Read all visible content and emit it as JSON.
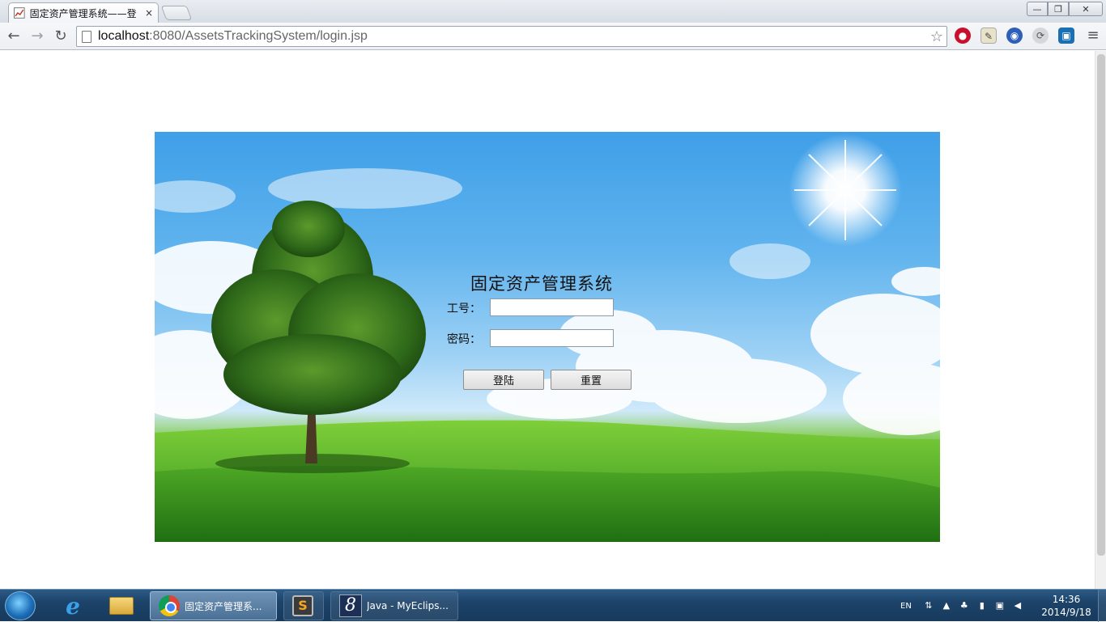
{
  "browser": {
    "tab_title": "固定资产管理系统——登",
    "tab_close": "×",
    "url_host": "localhost",
    "url_path": ":8080/AssetsTrackingSystem/login.jsp",
    "window_controls": {
      "minimize": "—",
      "maximize": "❐",
      "close": "✕"
    },
    "nav": {
      "back": "←",
      "forward": "→",
      "reload": "↻"
    },
    "bookmark_star": "☆",
    "menu": "≡"
  },
  "page": {
    "title": "固定资产管理系统",
    "id_label": "工号：",
    "password_label": "密码：",
    "id_value": "",
    "password_value": "",
    "login_button": "登陆",
    "reset_button": "重置"
  },
  "taskbar": {
    "tasks": [
      {
        "label": "固定资产管理系..."
      },
      {
        "label": ""
      },
      {
        "label": "Java - MyEclips..."
      }
    ],
    "tray_lang": "EN",
    "clock_time": "14:36",
    "clock_date": "2014/9/18"
  },
  "icons": {
    "favicon": "chart-favicon-icon",
    "ext_1": "adblock-icon",
    "ext_2": "notes-extension-icon",
    "ext_3": "globe-extension-icon",
    "ext_4": "sync-extension-icon",
    "ext_5": "dictionary-extension-icon"
  },
  "colors": {
    "sky_top": "#3f9fe8",
    "grass": "#2a8a1c",
    "taskbar": "#1d4369"
  }
}
